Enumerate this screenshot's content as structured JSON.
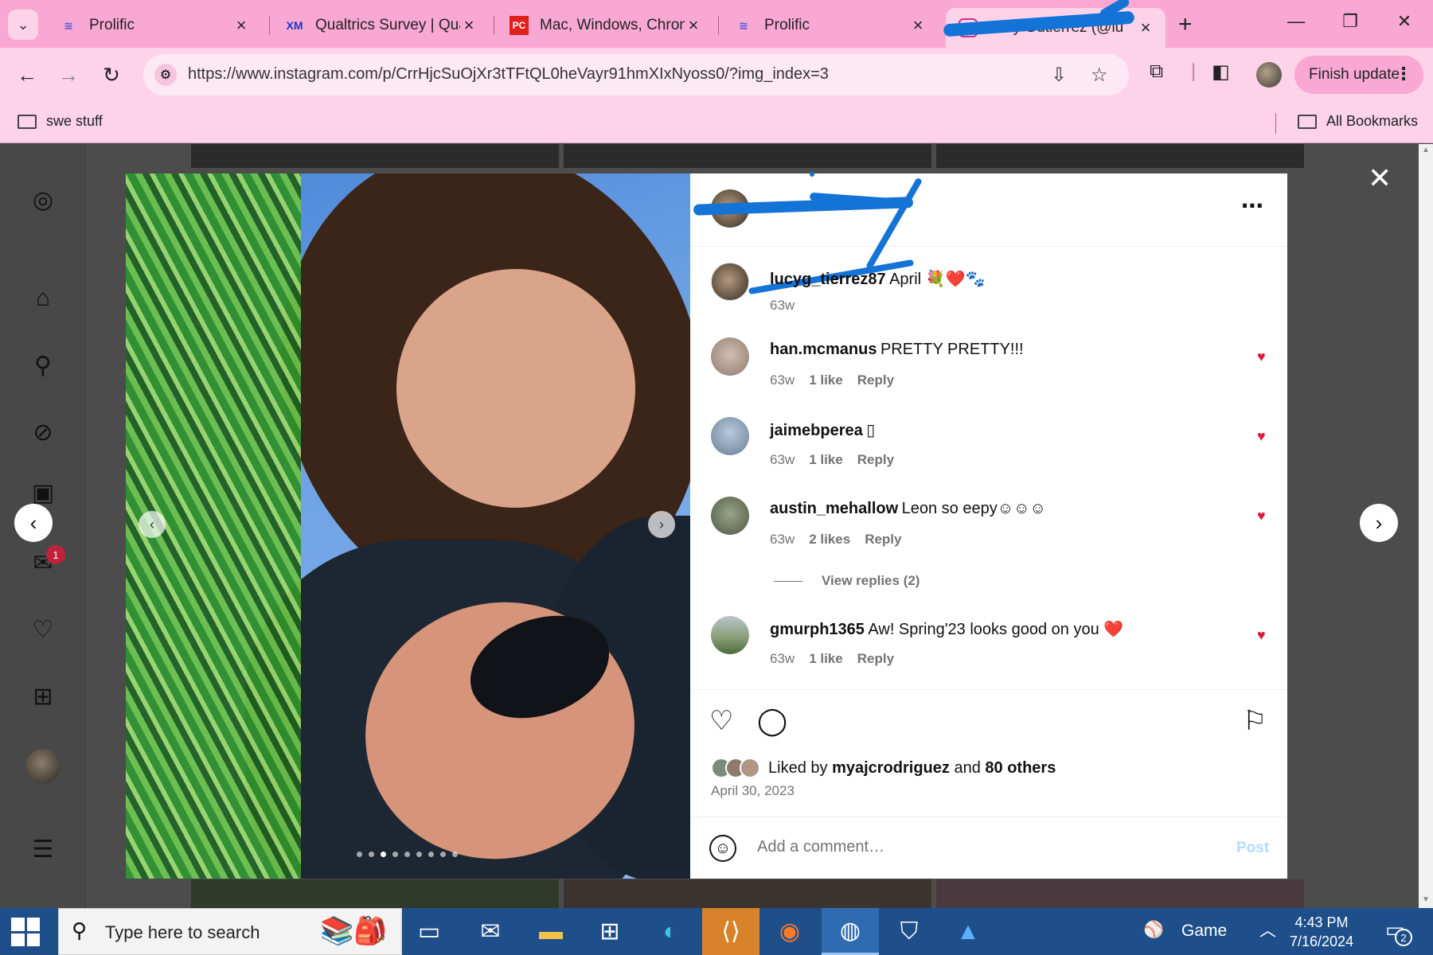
{
  "browser": {
    "tabs": [
      {
        "title": "Prolific",
        "icon": "prolific-icon",
        "color": "#4b5bd6"
      },
      {
        "title": "Qualtrics Survey | Qua",
        "icon": "qualtrics-icon",
        "color": "#1a36c8",
        "icon_text": "XM"
      },
      {
        "title": "Mac, Windows, Chron",
        "icon": "pcmag-icon",
        "color": "#e0201b",
        "icon_text": "PC"
      },
      {
        "title": "Prolific",
        "icon": "prolific-icon",
        "color": "#4b5bd6"
      },
      {
        "title": "Lucy Gutierrez (@lu",
        "icon": "instagram-icon",
        "color": "#c13584",
        "active": true
      }
    ],
    "url": "https://www.instagram.com/p/CrrHjcSuOjXr3tTFtQL0heVayr91hmXIxNyoss0/?img_index=3",
    "finish_update_label": "Finish update",
    "bookmarks": {
      "left": "swe stuff",
      "right": "All Bookmarks"
    },
    "colors": {
      "frame": "#f9a8d4",
      "toolbar": "#fcd3e8"
    }
  },
  "instagram": {
    "post": {
      "author_redacted": "lucy_gutierrez",
      "caption": {
        "user": "lucyg_tierrez87",
        "text": "April 💐❤️🐾",
        "age": "63w"
      },
      "comments": [
        {
          "user": "han.mcmanus",
          "text": "PRETTY PRETTY!!!",
          "age": "63w",
          "likes": "1 like",
          "reply": "Reply",
          "liked": true
        },
        {
          "user": "jaimebperea",
          "text": "▯",
          "age": "63w",
          "likes": "1 like",
          "reply": "Reply",
          "liked": true
        },
        {
          "user": "austin_mehallow",
          "text": "Leon so eepy☺☺☺",
          "age": "63w",
          "likes": "2 likes",
          "reply": "Reply",
          "liked": true,
          "view_replies": "View replies (2)"
        },
        {
          "user": "gmurph1365",
          "text": "Aw! Spring'23 looks good on you ❤️",
          "age": "63w",
          "likes": "1 like",
          "reply": "Reply",
          "liked": true
        }
      ],
      "liked_by": {
        "prefix": "Liked by",
        "user": "myajcrodriguez",
        "and": "and",
        "others": "80 others"
      },
      "date": "April 30, 2023",
      "comment_placeholder": "Add a comment…",
      "post_label": "Post"
    }
  },
  "taskbar": {
    "search_placeholder": "Type here to search",
    "game_label": "Game",
    "time": "4:43 PM",
    "date": "7/16/2024",
    "notification_count": "2"
  },
  "notification_badge": "1"
}
